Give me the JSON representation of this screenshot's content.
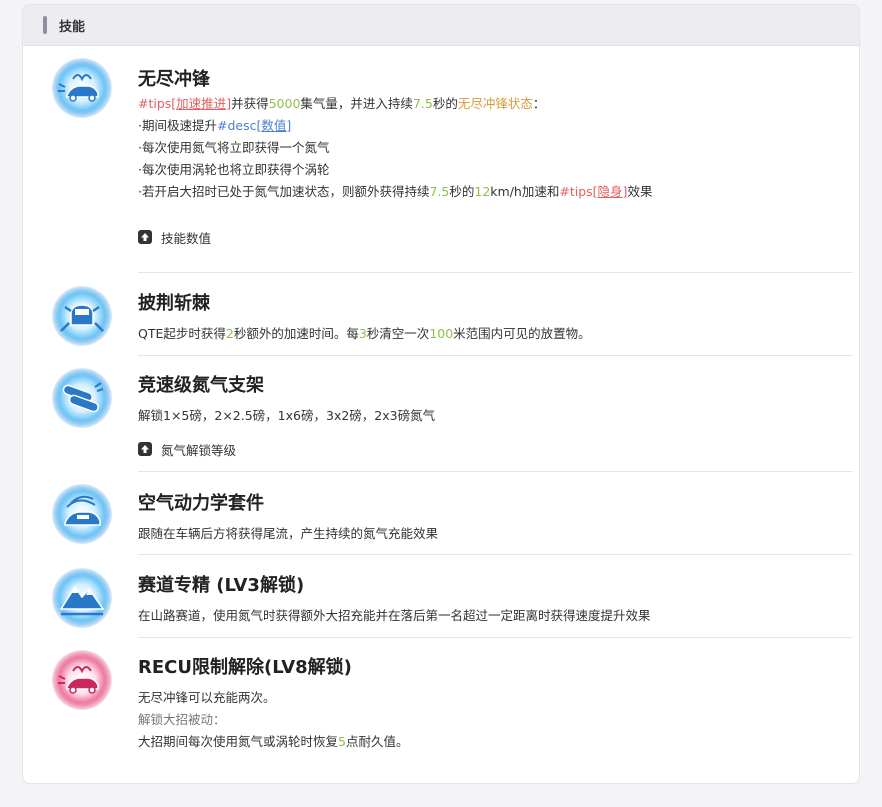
{
  "panel": {
    "title": "技能"
  },
  "colors": {
    "accent_green": "#8bc34a",
    "accent_orange": "#d89a3c",
    "accent_red": "#e35f5f",
    "accent_blue": "#4a7fd0"
  },
  "skills": [
    {
      "name": "无尽冲锋",
      "icon": "car-wings-icon",
      "l1": {
        "a": "#tips[",
        "b": "加速推进",
        "c": "]",
        "d": "并获得",
        "e": "5000",
        "f": "集气量，并进入持续",
        "g": "7.5",
        "h": "秒的",
        "i": "无尽冲锋状态",
        "j": "："
      },
      "l2": {
        "a": "·期间极速提升",
        "b": "#desc[",
        "c": "数值",
        "d": "]"
      },
      "l3": "·每次使用氮气将立即获得一个氮气",
      "l4": "·每次使用涡轮也将立即获得个涡轮",
      "l5": {
        "a": "·若开启大招时已处于氮气加速状态，则额外获得持续",
        "b": "7.5",
        "c": "秒的",
        "d": "12",
        "e": "km/h加速和",
        "f": "#tips[",
        "g": "隐身",
        "h": "]",
        "i": "效果"
      },
      "toggle": "技能数值"
    },
    {
      "name": "披荆斩棘",
      "icon": "car-burst-icon",
      "l1": {
        "a": "QTE起步时获得",
        "b": "2",
        "c": "秒额外的加速时间。每",
        "d": "3",
        "e": "秒清空一次",
        "f": "100",
        "g": "米范围内可见的放置物。"
      }
    },
    {
      "name": "竞速级氮气支架",
      "icon": "nitro-tanks-icon",
      "l1": "解锁1×5磅，2×2.5磅，1x6磅，3x2磅，2x3磅氮气",
      "toggle": "氮气解锁等级"
    },
    {
      "name": "空气动力学套件",
      "icon": "car-airflow-icon",
      "l1": "跟随在车辆后方将获得尾流，产生持续的氮气充能效果"
    },
    {
      "name": "赛道专精 (LV3解锁)",
      "icon": "mountain-icon",
      "l1": "在山路赛道，使用氮气时获得额外大招充能并在落后第一名超过一定距离时获得速度提升效果"
    },
    {
      "name": "RECU限制解除(LV8解锁)",
      "icon": "car-wings-red-icon",
      "l1": "无尽冲锋可以充能两次。",
      "l2": "解锁大招被动：",
      "l3": {
        "a": "大招期间每次使用氮气或涡轮时恢复",
        "b": "5",
        "c": "点耐久值。"
      }
    }
  ]
}
